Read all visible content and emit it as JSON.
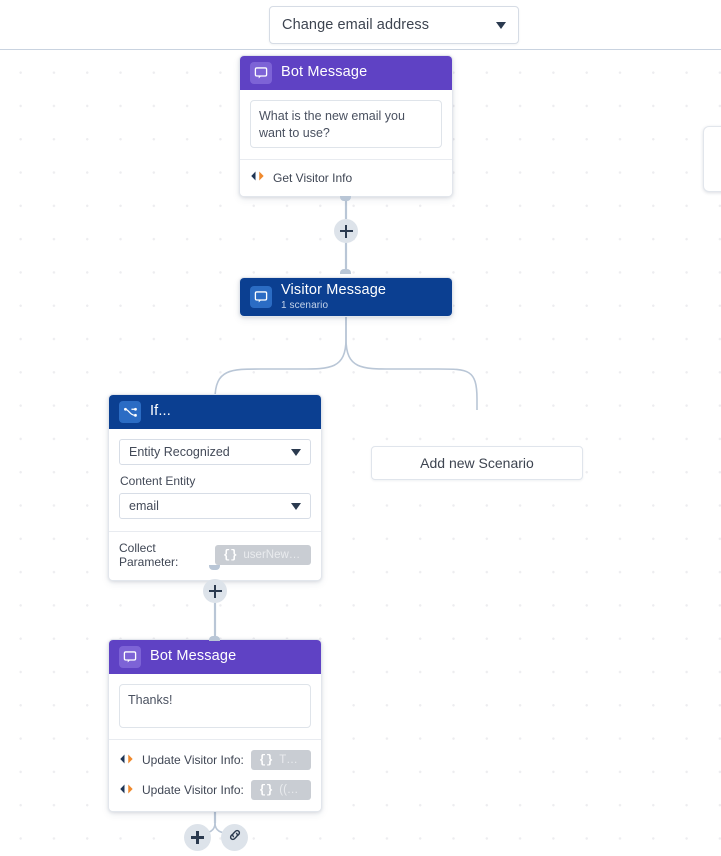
{
  "header": {
    "dialog_select_value": "Change email address",
    "dropdown_icon": "chevron-down-icon"
  },
  "canvas": {
    "background": "dotted-grid",
    "accent_purple": "#5f42c4",
    "accent_blue": "#0b3f91",
    "wire_color": "#b9c6d6"
  },
  "nodes": {
    "bot_message_top": {
      "title": "Bot Message",
      "icon": "chat-bubble-icon",
      "message": "What is the new email you want to use?",
      "actions": [
        {
          "icon": "get-visitor-info-icon",
          "label": "Get Visitor Info"
        }
      ]
    },
    "visitor_message": {
      "title": "Visitor Message",
      "subtitle": "1 scenario",
      "icon": "chat-bubble-icon"
    },
    "if_node": {
      "title": "If...",
      "icon": "branch-icon",
      "condition_value": "Entity Recognized",
      "entity_label": "Content Entity",
      "entity_value": "email",
      "collect_parameter_label": "Collect Parameter:",
      "collect_parameter_chip": {
        "braces": "{}",
        "text": "userNewEmail"
      }
    },
    "bot_message_bottom": {
      "title": "Bot Message",
      "icon": "chat-bubble-icon",
      "message": "Thanks!",
      "actions": [
        {
          "icon": "update-visitor-info-icon",
          "label": "Update Visitor Info:",
          "chip": {
            "braces": "{}",
            "text": "The use..."
          }
        },
        {
          "icon": "update-visitor-info-icon",
          "label": "Update Visitor Info:",
          "chip": {
            "braces": "{}",
            "text": "((userNe..."
          }
        }
      ]
    }
  },
  "scenario_button": {
    "label": "Add new Scenario"
  },
  "footer_buttons": [
    {
      "name": "add-node-button",
      "icon": "plus-icon"
    },
    {
      "name": "link-node-button",
      "icon": "link-icon"
    }
  ],
  "connector_buttons": [
    {
      "name": "add-between-bot-and-visitor",
      "icon": "plus-icon"
    },
    {
      "name": "add-between-if-and-bot",
      "icon": "plus-icon"
    }
  ]
}
